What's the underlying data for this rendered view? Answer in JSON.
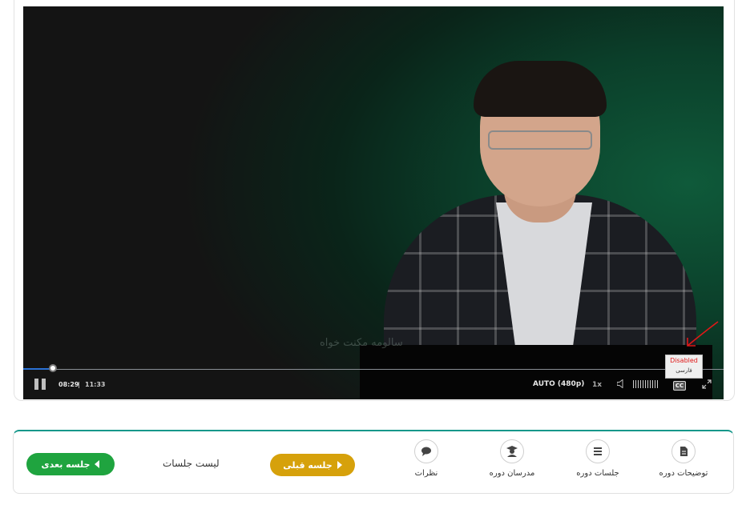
{
  "player": {
    "watermark": "سالومه مکنت خواه",
    "time_current": "08:29",
    "time_separator": "|",
    "time_total": "11:33",
    "progress_fraction": 0.04,
    "quality": "AUTO (480p)",
    "speed": "1x",
    "cc_label": "CC",
    "captions_menu": {
      "disabled": "Disabled",
      "language": "فارسی"
    },
    "accent_color": "#2b72d6"
  },
  "course_nav": {
    "items": [
      {
        "label": "توضیحات دوره",
        "icon": "document-icon"
      },
      {
        "label": "جلسات دوره",
        "icon": "list-icon"
      },
      {
        "label": "مدرسان دوره",
        "icon": "teacher-icon"
      },
      {
        "label": "نظرات",
        "icon": "comment-icon"
      }
    ],
    "prev_label": "جلسه قبلی",
    "sessions_list_label": "لیست جلسات",
    "next_label": "جلسه بعدی",
    "colors": {
      "accent": "#14978a",
      "next": "#1fa43f",
      "prev": "#d6a10b"
    }
  }
}
